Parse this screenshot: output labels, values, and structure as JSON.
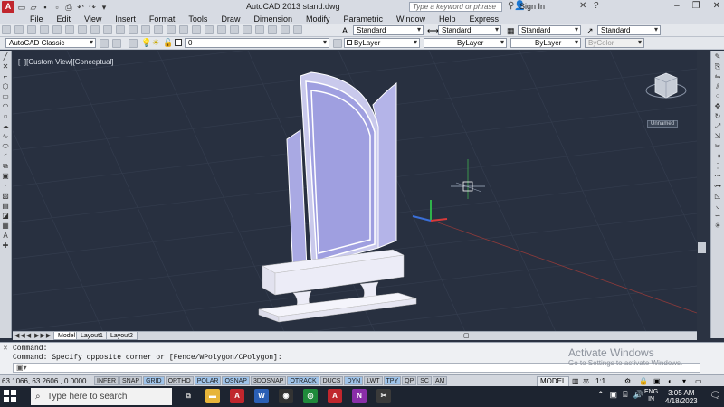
{
  "titlebar": {
    "app_title": "AutoCAD 2013    stand.dwg",
    "search_placeholder": "Type a keyword or phrase",
    "sign_in": "Sign In",
    "logo_text": "A"
  },
  "menu": [
    "File",
    "Edit",
    "View",
    "Insert",
    "Format",
    "Tools",
    "Draw",
    "Dimension",
    "Modify",
    "Parametric",
    "Window",
    "Help",
    "Express"
  ],
  "toolbar1": {
    "text_style": "Standard",
    "dim_style": "Standard",
    "table_style": "Standard",
    "mleader_style": "Standard"
  },
  "toolbar2": {
    "workspace": "AutoCAD Classic",
    "layer": "0",
    "color": "ByLayer",
    "linetype": "ByLayer",
    "lineweight": "ByLayer",
    "plotstyle": "ByColor"
  },
  "viewport": {
    "label": "[−][Custom View][Conceptual]",
    "viewcube_label": "Unnamed"
  },
  "tabs": [
    "Model",
    "Layout1",
    "Layout2"
  ],
  "command": {
    "line1": "Command:",
    "line2": "Command: Specify opposite corner or [Fence/WPolygon/CPolygon]:",
    "input_placeholder": ""
  },
  "watermark": {
    "line1": "Activate Windows",
    "line2": "Go to Settings to activate Windows."
  },
  "status": {
    "coords": "63.1066,  63.2606  , 0.0000",
    "modes": [
      {
        "label": "INFER",
        "on": false
      },
      {
        "label": "SNAP",
        "on": false
      },
      {
        "label": "GRID",
        "on": true
      },
      {
        "label": "ORTHO",
        "on": false
      },
      {
        "label": "POLAR",
        "on": true
      },
      {
        "label": "OSNAP",
        "on": true
      },
      {
        "label": "3DOSNAP",
        "on": false
      },
      {
        "label": "OTRACK",
        "on": true
      },
      {
        "label": "DUCS",
        "on": false
      },
      {
        "label": "DYN",
        "on": true
      },
      {
        "label": "LWT",
        "on": false
      },
      {
        "label": "TPY",
        "on": true
      },
      {
        "label": "QP",
        "on": false
      },
      {
        "label": "SC",
        "on": false
      },
      {
        "label": "AM",
        "on": false
      }
    ],
    "space": "MODEL",
    "scale": "1:1"
  },
  "taskbar": {
    "search_placeholder": "Type here to search",
    "lang": "ENG",
    "lang2": "IN",
    "time": "3:05 AM",
    "date": "4/18/2023"
  },
  "colors": {
    "model_face": "#9f9fe0",
    "model_edge": "#ffffff",
    "base_face": "#ececf7",
    "viewport_bg": "#283040"
  }
}
